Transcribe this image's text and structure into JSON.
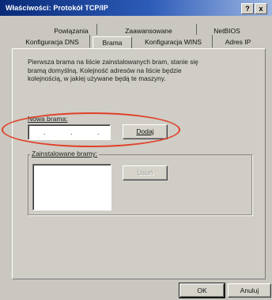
{
  "window": {
    "title": "Właściwości: Protokół TCP/IP",
    "help_button": "?",
    "close_button": "x"
  },
  "tabs": {
    "row1": [
      "Powiązania",
      "Zaawansowane",
      "NetBIOS"
    ],
    "row2": [
      "Konfiguracja DNS",
      "Brama",
      "Konfiguracja WINS",
      "Adres IP"
    ],
    "active": "Brama"
  },
  "content": {
    "description_lines": [
      "Pierwsza brama na liście zainstalowanych bram, stanie się",
      "bramą domyślną. Kolejność adresów na liście będzie",
      "kolejnością, w jakiej używane będą te maszyny."
    ],
    "new_gateway": {
      "label": "Nowa brama:",
      "value_dots": [
        ".",
        ".",
        "."
      ],
      "add_button": "Dodaj"
    },
    "installed_gateways": {
      "label": "Zainstalowane bramy:",
      "items": [],
      "remove_button": "Usuń"
    }
  },
  "footer": {
    "ok_button": "OK",
    "cancel_button": "Anuluj"
  },
  "colors": {
    "annotation_ellipse": "#e0402a",
    "titlebar_start": "#0a2a78"
  }
}
